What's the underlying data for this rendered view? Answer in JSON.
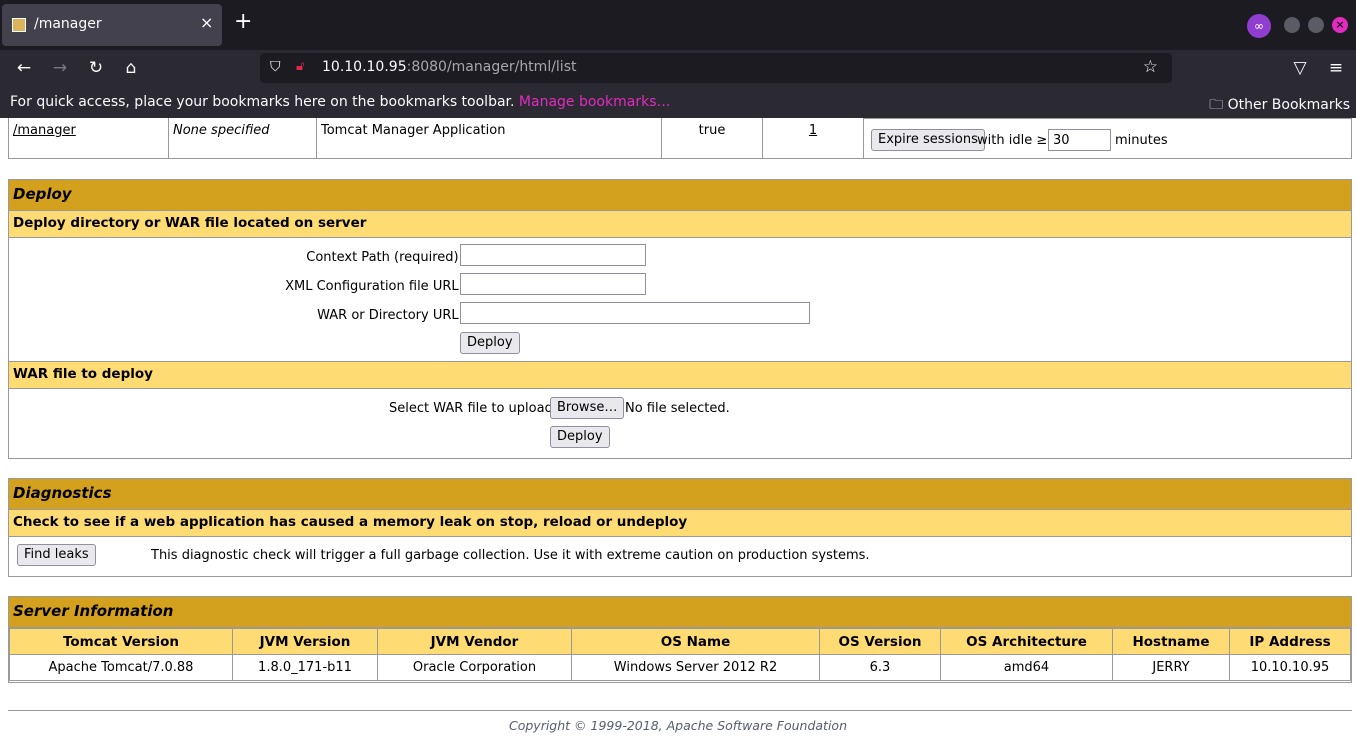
{
  "browser": {
    "tab_title": "/manager",
    "tab_close": "×",
    "new_tab": "+",
    "url_host": "10.10.10.95",
    "url_rest": ":8080/manager/html/list",
    "bookmarks_text": "For quick access, place your bookmarks here on the bookmarks toolbar.",
    "bookmarks_link": "Manage bookmarks…",
    "other_bookmarks": "Other Bookmarks",
    "icons": [
      "back-icon",
      "forward-icon",
      "reload-icon",
      "home-icon",
      "shield-icon",
      "lock-icon",
      "star-icon",
      "pocket-icon",
      "menu-icon",
      "private-browsing-icon"
    ]
  },
  "app_row": {
    "path": "/manager",
    "version": "None specified",
    "display_name": "Tomcat Manager Application",
    "running": "true",
    "sessions": "1",
    "expire_button": "Expire sessions",
    "with_idle": "with idle ≥",
    "idle_value": "30",
    "minutes": "minutes"
  },
  "deploy": {
    "title": "Deploy",
    "server_subtitle": "Deploy directory or WAR file located on server",
    "context_path_label": "Context Path (required):",
    "xml_config_label": "XML Configuration file URL:",
    "war_dir_label": "WAR or Directory URL:",
    "deploy_button": "Deploy",
    "war_subtitle": "WAR file to deploy",
    "select_war_label": "Select WAR file to upload",
    "browse_button": "Browse…",
    "no_file": "No file selected.",
    "deploy_button2": "Deploy"
  },
  "diagnostics": {
    "title": "Diagnostics",
    "subtitle": "Check to see if a web application has caused a memory leak on stop, reload or undeploy",
    "find_leaks_button": "Find leaks",
    "description": "This diagnostic check will trigger a full garbage collection. Use it with extreme caution on production systems."
  },
  "server_info": {
    "title": "Server Information",
    "headers": [
      "Tomcat Version",
      "JVM Version",
      "JVM Vendor",
      "OS Name",
      "OS Version",
      "OS Architecture",
      "Hostname",
      "IP Address"
    ],
    "values": [
      "Apache Tomcat/7.0.88",
      "1.8.0_171-b11",
      "Oracle Corporation",
      "Windows Server 2012 R2",
      "6.3",
      "amd64",
      "JERRY",
      "10.10.10.95"
    ]
  },
  "footer": "Copyright © 1999-2018, Apache Software Foundation"
}
